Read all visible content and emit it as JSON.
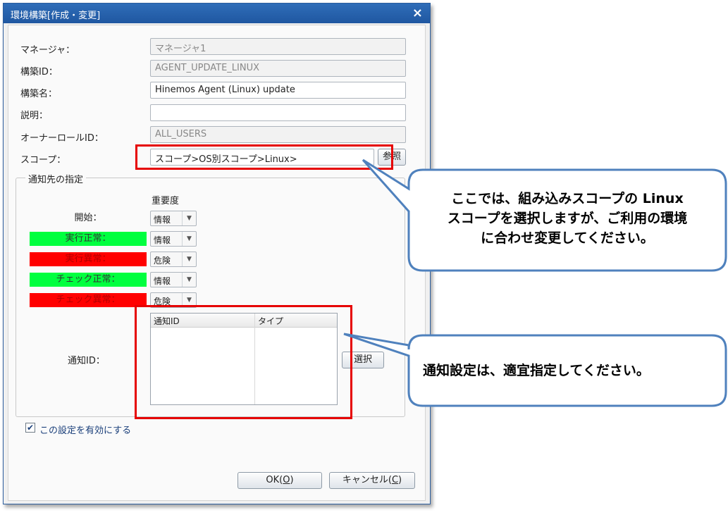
{
  "window": {
    "title": "環境構築[作成・変更]",
    "close_symbol": "×"
  },
  "form": {
    "manager": {
      "label": "マネージャ：",
      "value": "マネージャ1"
    },
    "build_id": {
      "label": "構築ID：",
      "value": "AGENT_UPDATE_LINUX"
    },
    "build_name": {
      "label": "構築名：",
      "value": "Hinemos Agent (Linux) update"
    },
    "description": {
      "label": "説明：",
      "value": ""
    },
    "owner_role": {
      "label": "オーナーロールID：",
      "value": "ALL_USERS"
    },
    "scope": {
      "label": "スコープ：",
      "value": "スコープ>OS別スコープ>Linux>",
      "browse_button": "参照"
    }
  },
  "notify": {
    "group_title": "通知先の指定",
    "severity_header": "重要度",
    "rows": [
      {
        "label": "開始：",
        "severity": "情報",
        "style": "plain"
      },
      {
        "label": "実行正常：",
        "severity": "情報",
        "style": "ok"
      },
      {
        "label": "実行異常：",
        "severity": "危険",
        "style": "ng"
      },
      {
        "label": "チェック正常：",
        "severity": "情報",
        "style": "ok"
      },
      {
        "label": "チェック異常：",
        "severity": "危険",
        "style": "ng"
      }
    ],
    "notify_id_label": "通知ID：",
    "table_headers": [
      "通知ID",
      "タイプ"
    ],
    "select_button": "選択"
  },
  "enable": {
    "checked": true,
    "check_symbol": "✔",
    "label": "この設定を有効にする"
  },
  "buttons": {
    "ok": "OK(",
    "ok_key": "O",
    "ok_end": ")",
    "cancel": "キャンセル(",
    "cancel_key": "C",
    "cancel_end": ")"
  },
  "callouts": {
    "scope_note_line1": "ここでは、組み込みスコープの Linux",
    "scope_note_line2": "スコープを選択しますが、ご利用の環境",
    "scope_note_line3": "に合わせ変更してください。",
    "notify_note": "通知設定は、適宜指定してください。"
  },
  "colors": {
    "title_bar": "#1f57a1",
    "ok_label_bg": "#00ff3f",
    "ng_label_bg": "#ff0000",
    "highlight": "#e60000",
    "callout_border": "#4f81bd"
  }
}
